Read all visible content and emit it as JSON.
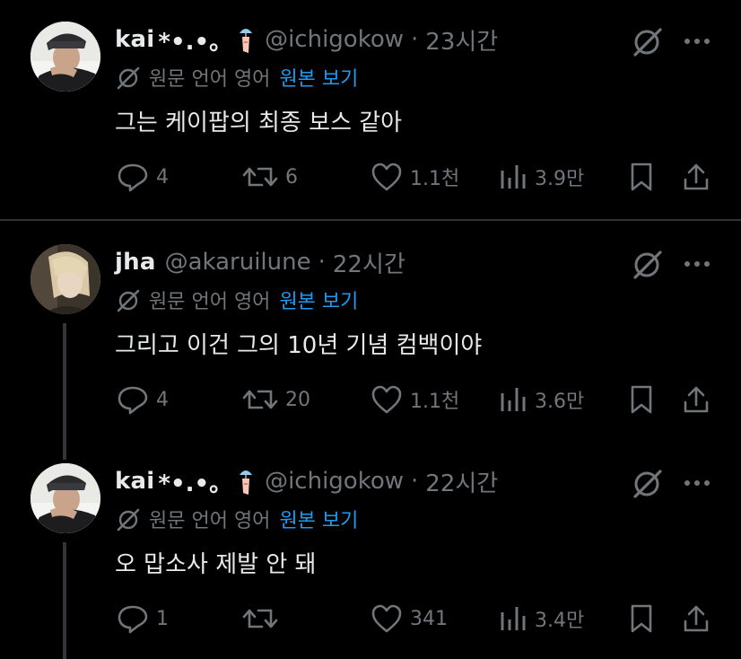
{
  "tweets": [
    {
      "name": "kai",
      "deco": "*•.•。",
      "handle": "@ichigokow",
      "separator": "·",
      "time": "23시간",
      "translate_label": "원문 언어 영어",
      "translate_link": "원본 보기",
      "text": "그는 케이팝의 최종 보스 같아",
      "replies": "4",
      "reposts": "6",
      "likes": "1.1천",
      "views": "3.9만"
    },
    {
      "name": "jha",
      "deco": "",
      "handle": "@akaruilune",
      "separator": "·",
      "time": "22시간",
      "translate_label": "원문 언어 영어",
      "translate_link": "원본 보기",
      "text": "그리고 이건 그의 10년 기념 컴백이야",
      "replies": "4",
      "reposts": "20",
      "likes": "1.1천",
      "views": "3.6만"
    },
    {
      "name": "kai",
      "deco": "*•.•。",
      "handle": "@ichigokow",
      "separator": "·",
      "time": "22시간",
      "translate_label": "원문 언어 영어",
      "translate_link": "원본 보기",
      "text": "오 맙소사 제발 안 돼",
      "replies": "1",
      "reposts": "",
      "likes": "341",
      "views": "3.4만"
    }
  ],
  "colors": {
    "background": "#000000",
    "text": "#e7e9ea",
    "muted": "#71767b",
    "link": "#1d9bf0",
    "divider": "#2f3336"
  },
  "icons": [
    "grok-icon",
    "more-icon",
    "reply-icon",
    "repost-icon",
    "like-icon",
    "views-icon",
    "bookmark-icon",
    "share-icon",
    "translate-icon"
  ]
}
